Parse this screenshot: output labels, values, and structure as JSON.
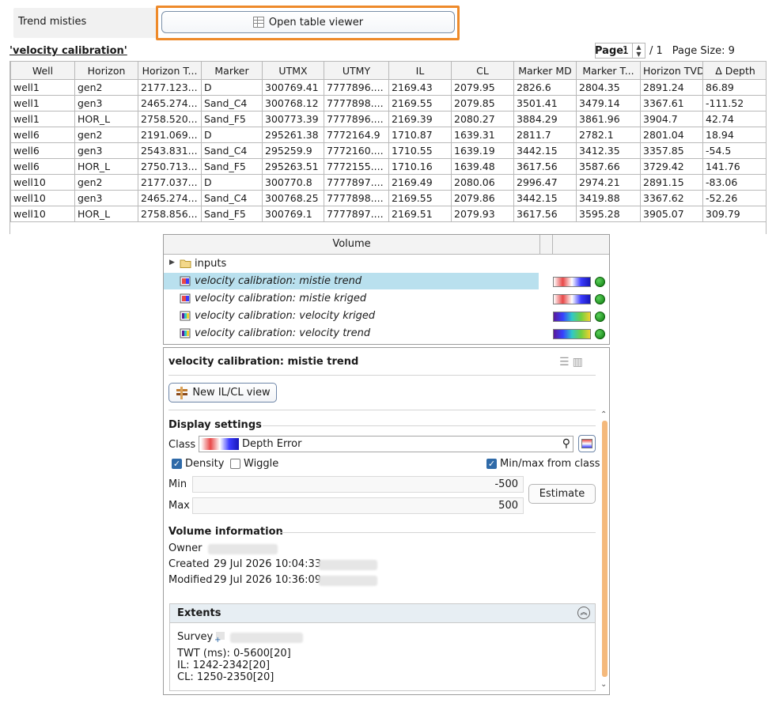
{
  "top": {
    "trend_label": "Trend misties",
    "open_viewer_label": "Open table viewer"
  },
  "table": {
    "title": "'velocity calibration'",
    "page_label": "Page:",
    "page_value": "1",
    "page_of": "/ 1",
    "page_size_label": "Page Size: 9",
    "columns": [
      "Well",
      "Horizon",
      "Horizon T...",
      "Marker",
      "UTMX",
      "UTMY",
      "IL",
      "CL",
      "Marker MD",
      "Marker T...",
      "Horizon TVD",
      "Δ Depth"
    ],
    "rows": [
      [
        "well1",
        "gen2",
        "2177.123...",
        "D",
        "300769.41",
        "7777896....",
        "2169.43",
        "2079.95",
        "2826.6",
        "2804.35",
        "2891.24",
        "86.89"
      ],
      [
        "well1",
        "gen3",
        "2465.274...",
        "Sand_C4",
        "300768.12",
        "7777898....",
        "2169.55",
        "2079.85",
        "3501.41",
        "3479.14",
        "3367.61",
        "-111.52"
      ],
      [
        "well1",
        "HOR_L",
        "2758.520...",
        "Sand_F5",
        "300773.39",
        "7777896....",
        "2169.39",
        "2080.27",
        "3884.29",
        "3861.96",
        "3904.7",
        "42.74"
      ],
      [
        "well6",
        "gen2",
        "2191.069...",
        "D",
        "295261.38",
        "7772164.9",
        "1710.87",
        "1639.31",
        "2811.7",
        "2782.1",
        "2801.04",
        "18.94"
      ],
      [
        "well6",
        "gen3",
        "2543.831...",
        "Sand_C4",
        "295259.9",
        "7772160....",
        "1710.55",
        "1639.19",
        "3442.15",
        "3412.35",
        "3357.85",
        "-54.5"
      ],
      [
        "well6",
        "HOR_L",
        "2750.713...",
        "Sand_F5",
        "295263.51",
        "7772155....",
        "1710.16",
        "1639.48",
        "3617.56",
        "3587.66",
        "3729.42",
        "141.76"
      ],
      [
        "well10",
        "gen2",
        "2177.037...",
        "D",
        "300770.8",
        "7777897....",
        "2169.49",
        "2080.06",
        "2996.47",
        "2974.21",
        "2891.15",
        "-83.06"
      ],
      [
        "well10",
        "gen3",
        "2465.274...",
        "Sand_C4",
        "300768.25",
        "7777898....",
        "2169.55",
        "2079.86",
        "3442.15",
        "3419.88",
        "3367.62",
        "-52.26"
      ],
      [
        "well10",
        "HOR_L",
        "2758.856...",
        "Sand_F5",
        "300769.1",
        "7777897....",
        "2169.51",
        "2079.93",
        "3617.56",
        "3595.28",
        "3905.07",
        "309.79"
      ]
    ]
  },
  "tree": {
    "header": "Volume",
    "folder": "inputs",
    "items": [
      {
        "label": "velocity calibration: mistie trend",
        "colorbar": "red-white-blue"
      },
      {
        "label": "velocity calibration: mistie kriged",
        "colorbar": "red-white-blue"
      },
      {
        "label": "velocity calibration: velocity kriged",
        "colorbar": "rainbow"
      },
      {
        "label": "velocity calibration: velocity trend",
        "colorbar": "rainbow"
      }
    ]
  },
  "props": {
    "title": "velocity calibration: mistie trend",
    "new_view_label": "New IL/CL view",
    "display_settings": "Display settings",
    "class_label": "Class",
    "class_name": "Depth Error",
    "density_label": "Density",
    "wiggle_label": "Wiggle",
    "minmax_label": "Min/max from class",
    "min_label": "Min",
    "min_value": "-500",
    "max_label": "Max",
    "max_value": "500",
    "estimate_label": "Estimate",
    "volume_info": "Volume information",
    "owner_label": "Owner",
    "created_label": "Created",
    "created_value": "29 Jul 2026 10:04:33",
    "modified_label": "Modified",
    "modified_value": "29 Jul 2026 10:36:09",
    "extents_label": "Extents",
    "survey_label": "Survey",
    "twt": "TWT (ms): 0-5600[20]",
    "il": "IL: 1242-2342[20]",
    "cl": "CL: 1250-2350[20]"
  },
  "colors": {
    "highlight": "#ee8a2a",
    "selection": "#b9e0ee",
    "accent": "#2f6aa8"
  }
}
